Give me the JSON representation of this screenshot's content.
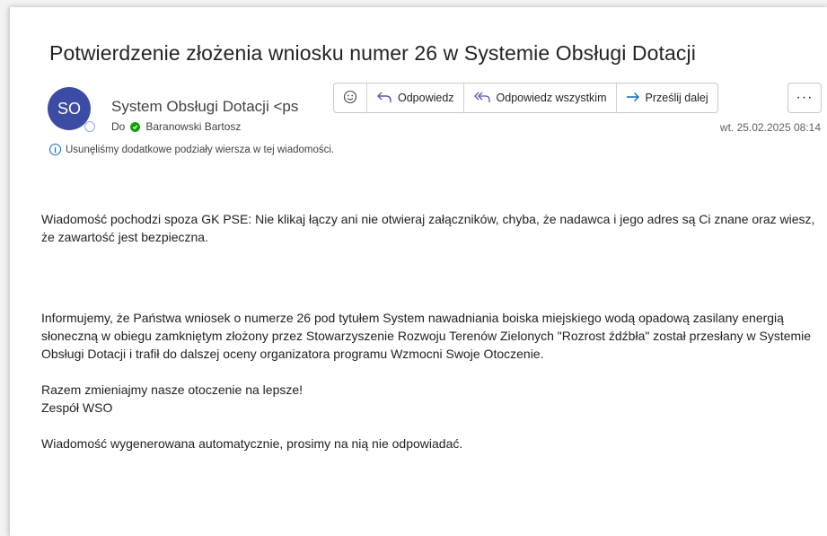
{
  "email": {
    "subject": "Potwierdzenie złożenia wniosku numer  26 w Systemie Obsługi Dotacji",
    "sender_name": "System Obsługi Dotacji <ps",
    "avatar_initials": "SO",
    "to_label": "Do",
    "recipient": "Baranowski Bartosz",
    "date": "wt. 25.02.2025 08:14",
    "notice": "Usunęliśmy dodatkowe podziały wiersza w tej wiadomości."
  },
  "toolbar": {
    "reply": "Odpowiedz",
    "reply_all": "Odpowiedz wszystkim",
    "forward": "Prześlij dalej",
    "more": "···"
  },
  "body": {
    "warning": "Wiadomość pochodzi spoza GK PSE: Nie klikaj łączy ani nie otwieraj załączników, chyba, że nadawca i jego adres są Ci znane oraz wiesz, że zawartość jest bezpieczna.",
    "info": "Informujemy, że Państwa wniosek o numerze  26 pod tytułem System nawadniania boiska miejskiego wodą opadową zasilany energią słoneczną w obiegu zamkniętym złożony przez Stowarzyszenie Rozwoju Terenów Zielonych \"Rozrost źdźbła\" został przesłany w Systemie Obsługi Dotacji i trafił do dalszej oceny organizatora programu Wzmocni Swoje Otoczenie.",
    "closing_line1": "Razem zmieniajmy nasze otoczenie na lepsze!",
    "closing_line2": "Zespół WSO",
    "auto_note": "Wiadomość wygenerowana automatycznie, prosimy na nią nie odpowiadać."
  },
  "colors": {
    "avatar": "#3c4ba3",
    "accent": "#0f6cbd",
    "presence_ok": "#13a10e"
  }
}
